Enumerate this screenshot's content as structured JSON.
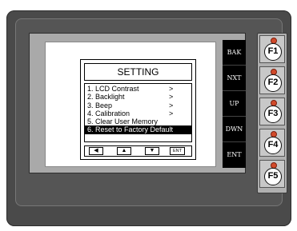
{
  "colors": {
    "bezel": "#4a4a4a",
    "lcd_frame": "#a9a9a9",
    "side_keys": "#000000",
    "led": "#d24a2a",
    "fkey_panel": "#b0b0b0"
  },
  "dialog": {
    "title": "SETTING",
    "items": [
      {
        "label": "1. LCD Contrast",
        "arrow": ">"
      },
      {
        "label": "2. Backlight",
        "arrow": ">"
      },
      {
        "label": "3. Beep",
        "arrow": ">"
      },
      {
        "label": "4. Calibration",
        "arrow": ">"
      },
      {
        "label": "5. Clear User Memory",
        "arrow": ""
      },
      {
        "label": "6. Reset to Factory Default",
        "arrow": ""
      }
    ],
    "selected_index": 5,
    "nav": {
      "left": "◀",
      "up": "▲",
      "down": "▼",
      "enter": "ENT"
    }
  },
  "side_keys": [
    "BAK",
    "NXT",
    "UP",
    "DWN",
    "ENT"
  ],
  "function_keys": [
    "F1",
    "F2",
    "F3",
    "F4",
    "F5"
  ]
}
